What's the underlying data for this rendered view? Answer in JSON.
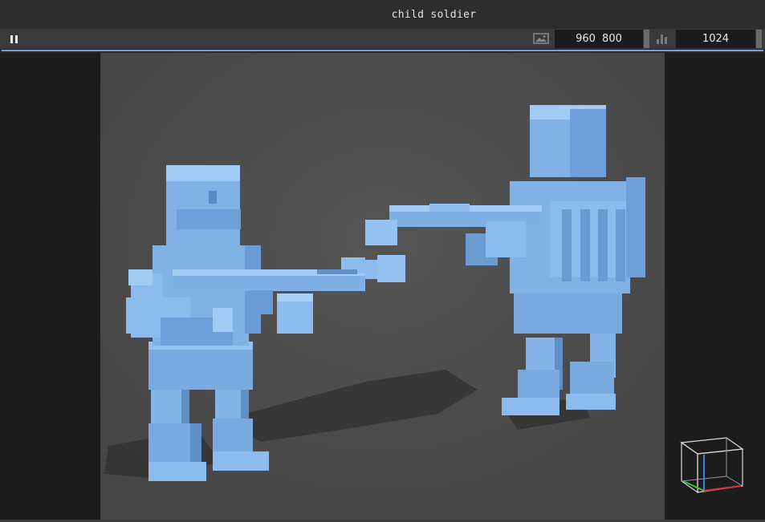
{
  "window": {
    "title": "child soldier"
  },
  "toolbar": {
    "pause_icon": "pause-icon",
    "image_icon": "image-icon",
    "resolution": "960  800",
    "chart_icon": "bar-chart-icon",
    "samples": "1024"
  },
  "render": {
    "progress": 1.0,
    "accent_color": "#6e9fe0",
    "voxel_color": "#7fb0e6",
    "background_color": "#4d4d4d"
  },
  "gizmo": {
    "icon": "view-cube-icon"
  }
}
